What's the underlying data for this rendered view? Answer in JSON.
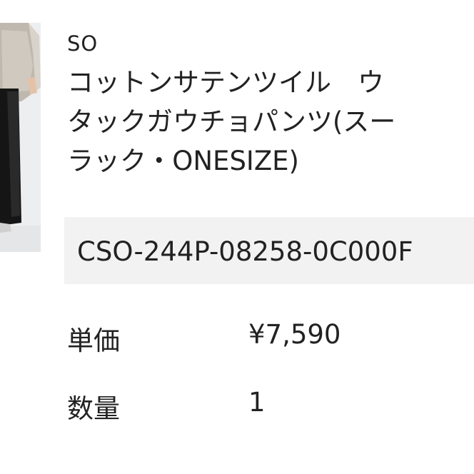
{
  "product": {
    "brand": "SO",
    "title_lines": [
      "コットンサテンツイル　ウ",
      "タックガウチョパンツ(スー",
      "ラック・ONESIZE)"
    ],
    "code": "CSO-244P-08258-0C000F"
  },
  "details": {
    "price_label": "単価",
    "price_value": "¥7,590",
    "quantity_label": "数量",
    "quantity_value": "1"
  },
  "colors": {
    "code_box_bg": "#f2f2f2",
    "text": "#222222"
  }
}
